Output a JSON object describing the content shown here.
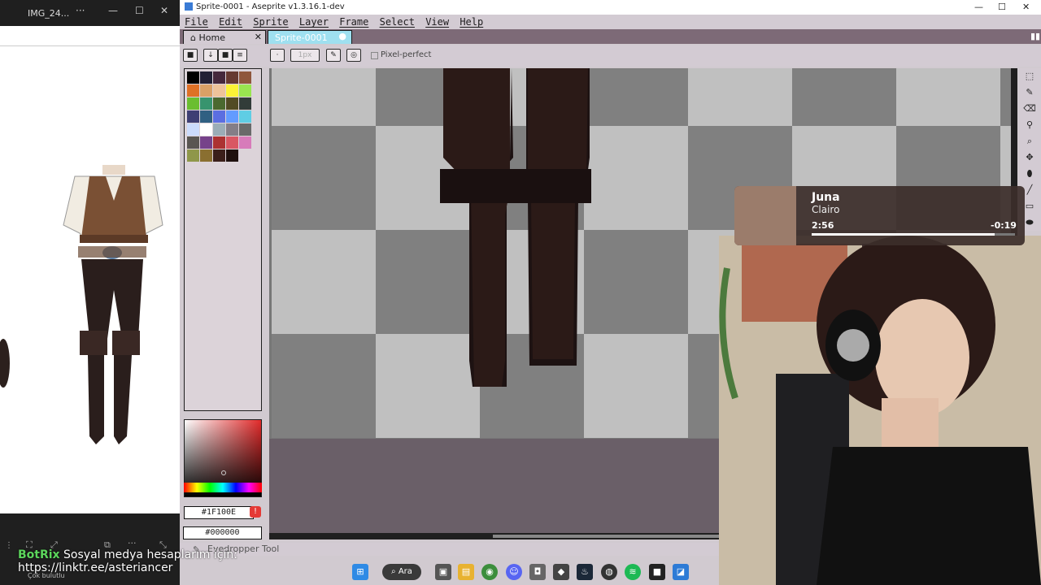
{
  "viewer": {
    "title": "IMG_24...",
    "more_label": "···",
    "min_label": "—",
    "max_label": "☐",
    "close_label": "✕",
    "footer_status": "Çok bulutlu"
  },
  "aseprite": {
    "window_title": "Sprite-0001 - Aseprite v1.3.16.1-dev",
    "menu": [
      "File",
      "Edit",
      "Sprite",
      "Layer",
      "Frame",
      "Select",
      "View",
      "Help"
    ],
    "tabs": [
      {
        "label": "Home"
      },
      {
        "label": "Sprite-0001"
      }
    ],
    "context_bar": {
      "brush_size": "1px",
      "pixel_perfect_label": "Pixel-perfect"
    },
    "colors": {
      "foreground_hex": "#1F100E",
      "background_hex": "#000000"
    },
    "status_text": "Eyedropper Tool",
    "palette": [
      "#000000",
      "#222034",
      "#45283c",
      "#663931",
      "#8f563b",
      "#df7126",
      "#d9a066",
      "#eec39a",
      "#fbf236",
      "#99e550",
      "#6abe30",
      "#37946e",
      "#4b692f",
      "#524b24",
      "#323c39",
      "#3f3f74",
      "#306082",
      "#5b6ee1",
      "#639bff",
      "#5fcde4",
      "#cbdbfc",
      "#ffffff",
      "#9badb7",
      "#847e87",
      "#696a6a",
      "#595652",
      "#76428a",
      "#ac3232",
      "#d95763",
      "#d77bba",
      "#8f974a",
      "#8a6f30",
      "#3b1f1a",
      "#1f100e"
    ],
    "tools": [
      "marquee-icon",
      "pencil-icon",
      "eraser-icon",
      "eyedropper-icon",
      "zoom-icon",
      "move-icon",
      "bucket-icon",
      "line-icon",
      "rectangle-icon",
      "ellipse-icon"
    ]
  },
  "music": {
    "title": "Juna",
    "artist": "Clairo",
    "elapsed": "2:56",
    "remaining": "-0:19",
    "progress": 0.9
  },
  "chat": {
    "user": "BotRix",
    "message": "Sosyal medya hesaplarım için:",
    "link": "https://linktr.ee/asteriancer"
  },
  "taskbar": {
    "search_label": "Ara"
  }
}
